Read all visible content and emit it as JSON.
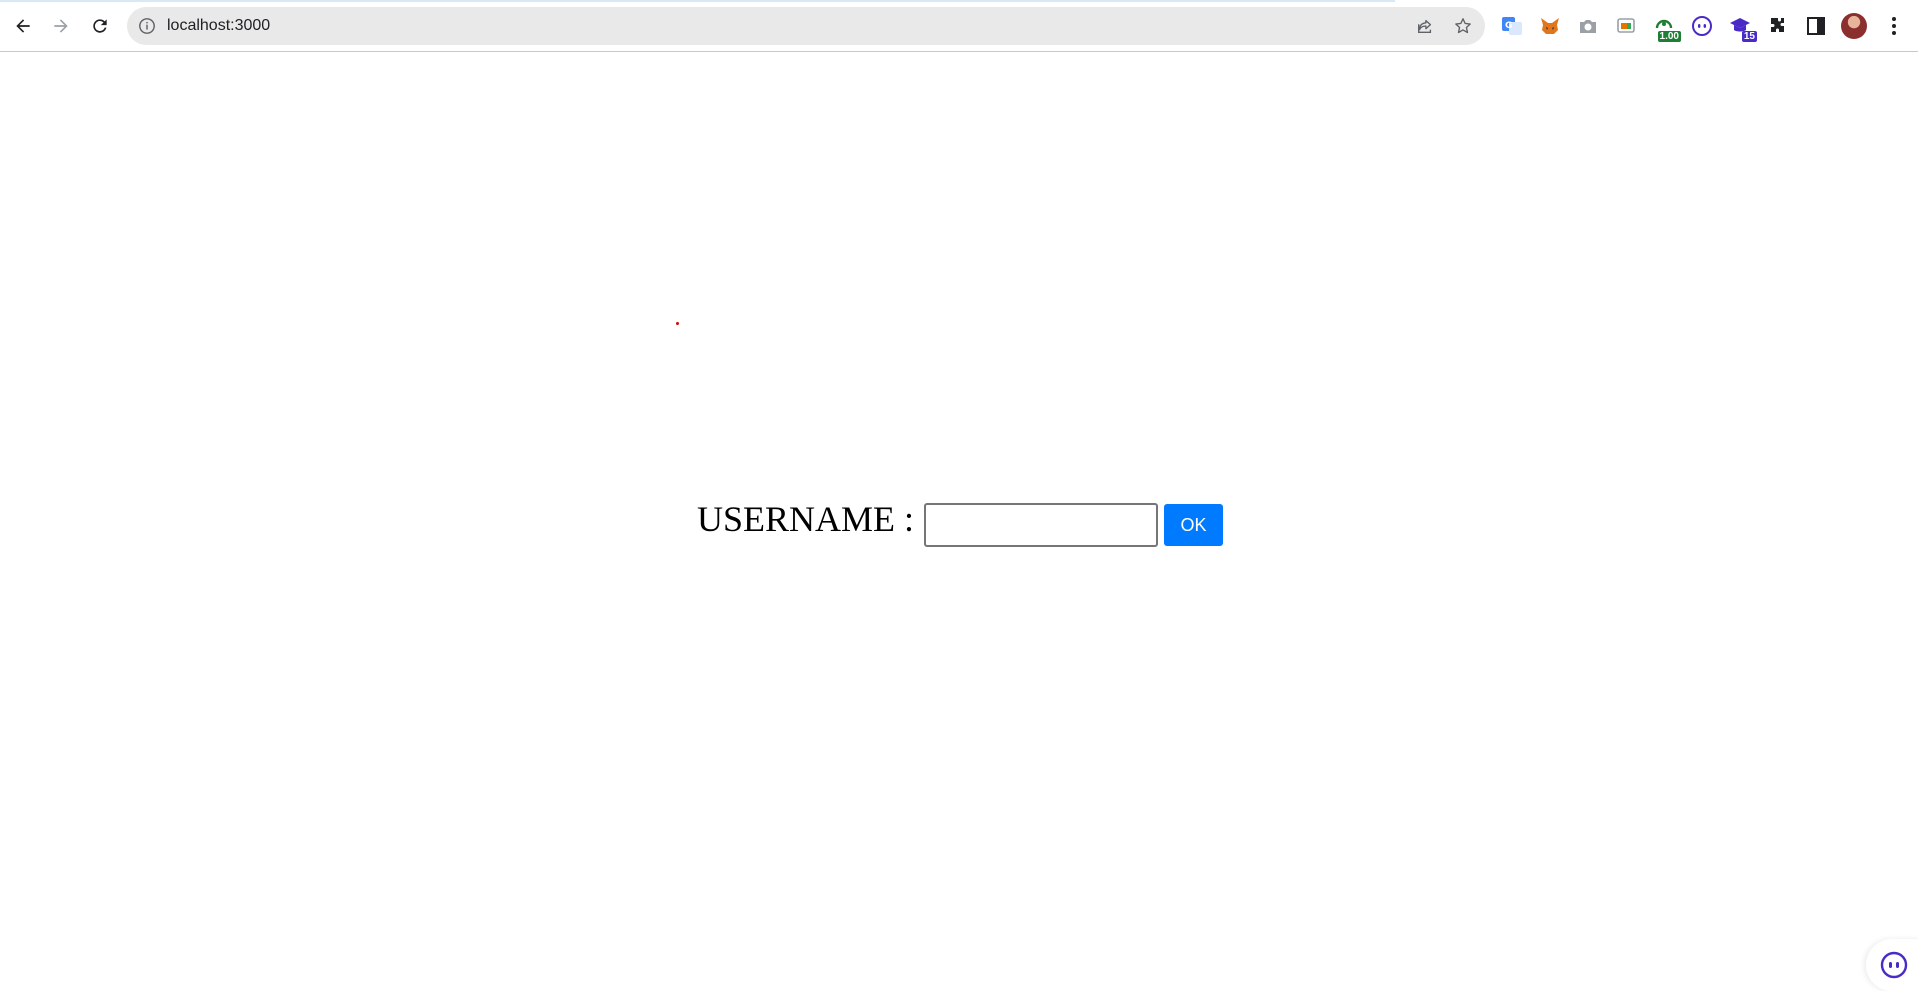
{
  "browser": {
    "url": "localhost:3000",
    "extensions": [
      {
        "name": "google-translate-icon",
        "badge": ""
      },
      {
        "name": "metamask-fox-icon",
        "badge": ""
      },
      {
        "name": "camera-icon",
        "badge": ""
      },
      {
        "name": "cast-screen-icon",
        "badge": ""
      },
      {
        "name": "ticker-extension-icon",
        "badge": "1.00"
      },
      {
        "name": "robot-face-icon",
        "badge": ""
      },
      {
        "name": "graduation-cap-icon",
        "badge": "15"
      },
      {
        "name": "puzzle-icon",
        "badge": ""
      },
      {
        "name": "side-panel-icon",
        "badge": ""
      }
    ]
  },
  "form": {
    "label": "USERNAME :",
    "input_value": "",
    "button_label": "OK"
  },
  "colors": {
    "button": "#007bff",
    "badge_green": "#1e7e34",
    "badge_purple": "#4b2bc7",
    "dot": "#e00000"
  }
}
